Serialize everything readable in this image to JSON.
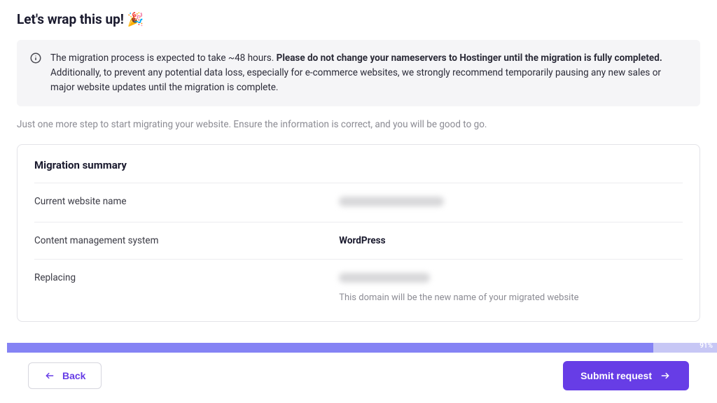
{
  "title": "Let's wrap this up! 🎉",
  "info": {
    "lead": "The migration process is expected to take ~48 hours. ",
    "bold": "Please do not change your nameservers to Hostinger until the migration is fully completed.",
    "tail": " Additionally, to prevent any potential data loss, especially for e-commerce websites, we strongly recommend temporarily pausing any new sales or major website updates until the migration is complete."
  },
  "intro": "Just one more step to start migrating your website. Ensure the information is correct, and you will be good to go.",
  "summary": {
    "heading": "Migration summary",
    "rows": {
      "website_label": "Current website name",
      "cms_label": "Content management system",
      "cms_value": "WordPress",
      "replacing_label": "Replacing",
      "replacing_subtext": "This domain will be the new name of your migrated website"
    }
  },
  "progress": {
    "percent": 91,
    "label": "91%"
  },
  "buttons": {
    "back": "Back",
    "submit": "Submit request"
  },
  "colors": {
    "accent": "#673de6",
    "progress_fill": "#8583f4",
    "progress_bg": "#c7c7f5"
  }
}
